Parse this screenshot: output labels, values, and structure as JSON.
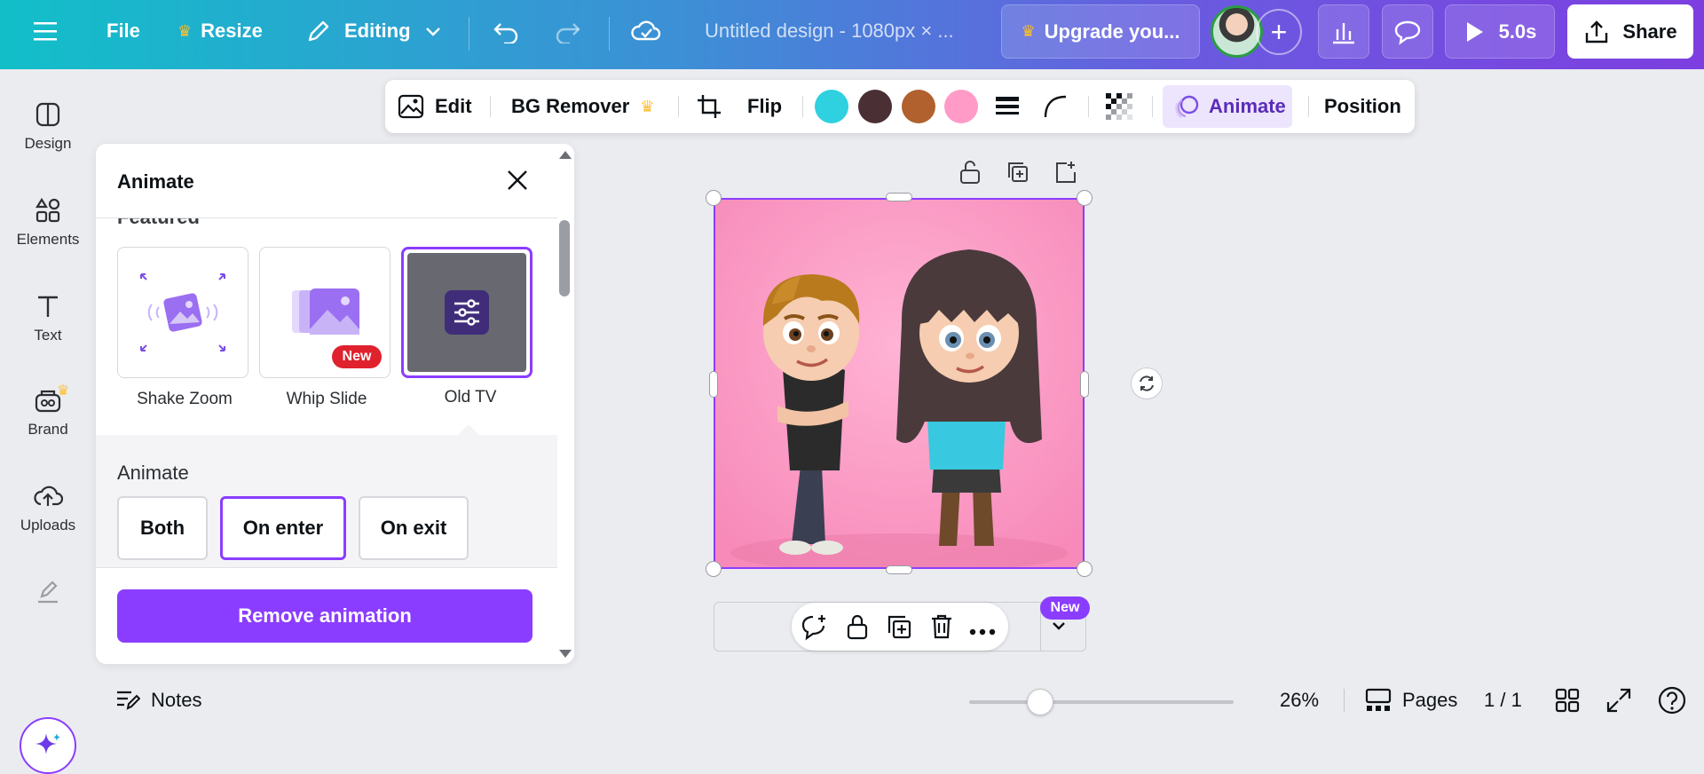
{
  "topbar": {
    "file": "File",
    "resize": "Resize",
    "editing": "Editing",
    "doc_title": "Untitled design - 1080px × ...",
    "upgrade": "Upgrade you...",
    "duration": "5.0s",
    "share": "Share"
  },
  "sidebar": {
    "items": [
      {
        "label": "Design"
      },
      {
        "label": "Elements"
      },
      {
        "label": "Text"
      },
      {
        "label": "Brand"
      },
      {
        "label": "Uploads"
      }
    ]
  },
  "context_toolbar": {
    "edit": "Edit",
    "bg_remover": "BG Remover",
    "flip": "Flip",
    "animate": "Animate",
    "position": "Position",
    "swatches": [
      "#2fd0e0",
      "#4a3034",
      "#b0612e",
      "#ff9bc6"
    ]
  },
  "panel": {
    "title": "Animate",
    "featured": "Featured",
    "cards": [
      {
        "label": "Shake Zoom"
      },
      {
        "label": "Whip Slide",
        "badge": "New"
      },
      {
        "label": "Old TV"
      }
    ],
    "animate_label": "Animate",
    "options": [
      "Both",
      "On enter",
      "On exit"
    ],
    "selected_option": "On enter",
    "remove": "Remove animation"
  },
  "canvas": {
    "new_badge": "New"
  },
  "bottombar": {
    "notes": "Notes",
    "zoom": "26%",
    "pages": "Pages",
    "page_count": "1 / 1"
  },
  "colors": {
    "accent": "#8b3dff",
    "new_red": "#e0212e"
  }
}
